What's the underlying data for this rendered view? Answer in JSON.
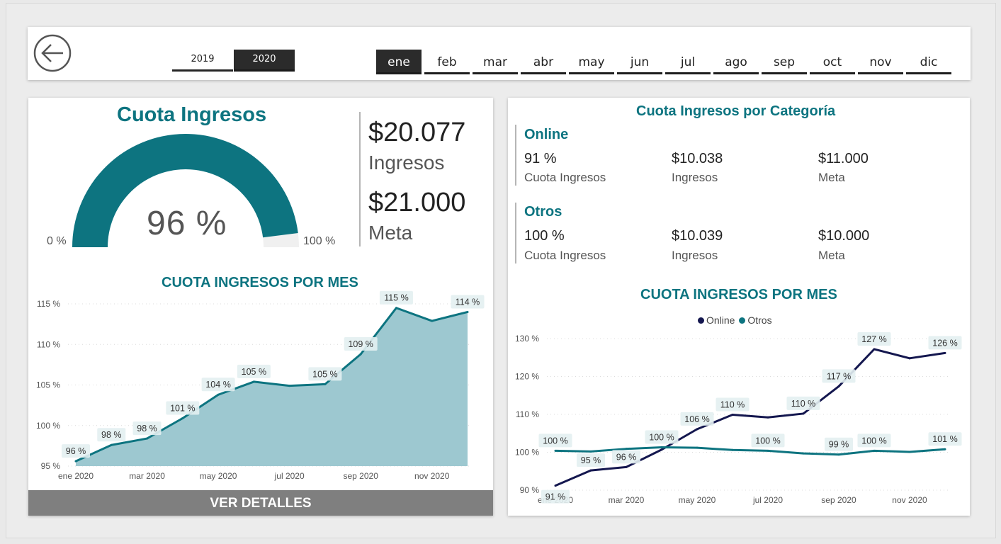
{
  "header": {
    "years": [
      {
        "label": "2019",
        "selected": false
      },
      {
        "label": "2020",
        "selected": true
      }
    ],
    "months": [
      {
        "label": "ene",
        "selected": true
      },
      {
        "label": "feb",
        "selected": false
      },
      {
        "label": "mar",
        "selected": false
      },
      {
        "label": "abr",
        "selected": false
      },
      {
        "label": "may",
        "selected": false
      },
      {
        "label": "jun",
        "selected": false
      },
      {
        "label": "jul",
        "selected": false
      },
      {
        "label": "ago",
        "selected": false
      },
      {
        "label": "sep",
        "selected": false
      },
      {
        "label": "oct",
        "selected": false
      },
      {
        "label": "nov",
        "selected": false
      },
      {
        "label": "dic",
        "selected": false
      }
    ],
    "back_icon": "arrow-left-circle-icon"
  },
  "gauge": {
    "title": "Cuota Ingresos",
    "value_label": "96 %",
    "value": 96,
    "min_label": "0 %",
    "max_label": "100 %",
    "fill_color": "#0d7480",
    "track_color": "#f0f0f0"
  },
  "kpis": {
    "ingresos_value": "$20.077",
    "ingresos_label": "Ingresos",
    "meta_value": "$21.000",
    "meta_label": "Meta"
  },
  "details_button": "VER DETALLES",
  "categories": {
    "title": "Cuota Ingresos por Categoría",
    "items": [
      {
        "name": "Online",
        "cuota_value": "91 %",
        "cuota_label": "Cuota Ingresos",
        "ingresos_value": "$10.038",
        "ingresos_label": "Ingresos",
        "meta_value": "$11.000",
        "meta_label": "Meta"
      },
      {
        "name": "Otros",
        "cuota_value": "100 %",
        "cuota_label": "Cuota Ingresos",
        "ingresos_value": "$10.039",
        "ingresos_label": "Ingresos",
        "meta_value": "$10.000",
        "meta_label": "Meta"
      }
    ]
  },
  "chart_data": [
    {
      "type": "area",
      "title": "CUOTA INGRESOS POR MES",
      "xlabel": "",
      "ylabel": "",
      "x": [
        "ene 2020",
        "feb 2020",
        "mar 2020",
        "abr 2020",
        "may 2020",
        "jun 2020",
        "jul 2020",
        "ago 2020",
        "sep 2020",
        "oct 2020",
        "nov 2020",
        "dic 2020"
      ],
      "x_tick_labels": [
        "ene 2020",
        "mar 2020",
        "may 2020",
        "jul 2020",
        "sep 2020",
        "nov 2020"
      ],
      "y_ticks": [
        "95 %",
        "100 %",
        "105 %",
        "110 %",
        "115 %"
      ],
      "ylim": [
        95,
        115
      ],
      "grid": true,
      "series": [
        {
          "values": [
            95.6,
            97.6,
            98.4,
            100.9,
            103.8,
            105.4,
            104.9,
            105.1,
            108.8,
            114.5,
            112.9,
            114.0
          ],
          "labels": [
            "96 %",
            "98 %",
            "98 %",
            "101 %",
            "104 %",
            "105 %",
            "",
            "105 %",
            "109 %",
            "115 %",
            "",
            "114 %"
          ],
          "color": "#0d7480",
          "fill": "#9dc8d0"
        }
      ]
    },
    {
      "type": "line",
      "title": "CUOTA INGRESOS POR MES",
      "xlabel": "",
      "ylabel": "",
      "x": [
        "ene 2020",
        "feb 2020",
        "mar 2020",
        "abr 2020",
        "may 2020",
        "jun 2020",
        "jul 2020",
        "ago 2020",
        "sep 2020",
        "oct 2020",
        "nov 2020",
        "dic 2020"
      ],
      "x_tick_labels": [
        "ene 2020",
        "mar 2020",
        "may 2020",
        "jul 2020",
        "sep 2020",
        "nov 2020"
      ],
      "y_ticks": [
        "90 %",
        "100 %",
        "110 %",
        "120 %",
        "130 %"
      ],
      "ylim": [
        90,
        130
      ],
      "grid": true,
      "legend": "top-center",
      "series": [
        {
          "name": "Online",
          "values": [
            91.2,
            95.2,
            96.1,
            100.7,
            106.1,
            109.9,
            109.2,
            110.2,
            117.4,
            127.2,
            124.8,
            126.2
          ],
          "labels": [
            "91 %",
            "95 %",
            "96 %",
            "",
            "106 %",
            "110 %",
            "",
            "110 %",
            "117 %",
            "127 %",
            "",
            "126 %"
          ],
          "color": "#14174f"
        },
        {
          "name": "Otros",
          "values": [
            100.4,
            100.2,
            100.9,
            101.3,
            101.2,
            100.6,
            100.4,
            99.7,
            99.4,
            100.4,
            100.1,
            100.8
          ],
          "labels": [
            "100 %",
            "",
            "",
            "100 %",
            "",
            "",
            "100 %",
            "",
            "99 %",
            "100 %",
            "",
            "101 %"
          ],
          "color": "#0d7480"
        }
      ]
    }
  ]
}
